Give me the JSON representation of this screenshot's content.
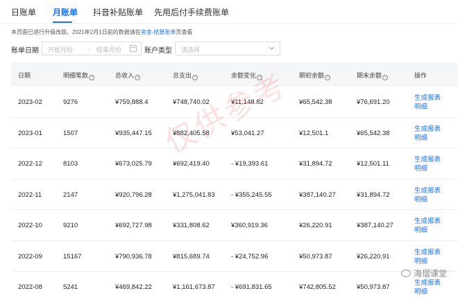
{
  "tabs": [
    {
      "label": "日账单"
    },
    {
      "label": "月账单"
    },
    {
      "label": "抖音补贴账单"
    },
    {
      "label": "先用后付手续费账单"
    }
  ],
  "notice": {
    "text": "本页面已进行升级改版。2021年2月1日前的数据请在",
    "link": "资金-结算账单",
    "suffix": "页查看"
  },
  "filters": {
    "date_label": "账单日期",
    "start_placeholder": "开始月份",
    "separator": "→",
    "end_placeholder": "结束月份",
    "account_label": "账户类型",
    "account_placeholder": "请选择"
  },
  "table": {
    "headers": [
      "日期",
      "明细笔数",
      "总收入",
      "总支出",
      "余额变化",
      "期初余额",
      "期末余额",
      "操作"
    ],
    "action_label": "生成报表明细",
    "rows": [
      {
        "date": "2023-02",
        "count": "9276",
        "income": "¥759,888.4",
        "expense": "¥748,740.02",
        "change": "¥11,148.82",
        "opening": "¥65,542.38",
        "closing": "¥76,691.20"
      },
      {
        "date": "2023-01",
        "count": "1507",
        "income": "¥935,447.15",
        "expense": "¥882,405.58",
        "change": "¥53,041.27",
        "opening": "¥12,501.1",
        "closing": "¥65,542.38"
      },
      {
        "date": "2022-12",
        "count": "8103",
        "income": "¥673,025.79",
        "expense": "¥692,419.40",
        "change": "- ¥19,393.61",
        "opening": "¥31,894.72",
        "closing": "¥12,501.11"
      },
      {
        "date": "2022-11",
        "count": "2147",
        "income": "¥920,796.28",
        "expense": "¥1,275,041.83",
        "change": "- ¥355,245.55",
        "opening": "¥387,140.27",
        "closing": "¥31,894.72"
      },
      {
        "date": "2022-10",
        "count": "9210",
        "income": "¥692,727.98",
        "expense": "¥331,808.62",
        "change": "¥360,919.36",
        "opening": "¥26,220.91",
        "closing": "¥387,140.27"
      },
      {
        "date": "2022-09",
        "count": "15167",
        "income": "¥790,936.78",
        "expense": "¥815,689.74",
        "change": "- ¥24,752.96",
        "opening": "¥50,973.87",
        "closing": "¥26,220.91"
      },
      {
        "date": "2022-08",
        "count": "5241",
        "income": "¥469,842.22",
        "expense": "¥1,161,673.87",
        "change": "- ¥691,831.65",
        "opening": "¥742,805.52",
        "closing": "¥50,973.87"
      }
    ]
  },
  "watermark": "仅供参考",
  "brand": "海熠课堂",
  "colors": {
    "accent": "#1f6fff",
    "header_bg": "#f5f6f8",
    "watermark": "#e44646"
  }
}
